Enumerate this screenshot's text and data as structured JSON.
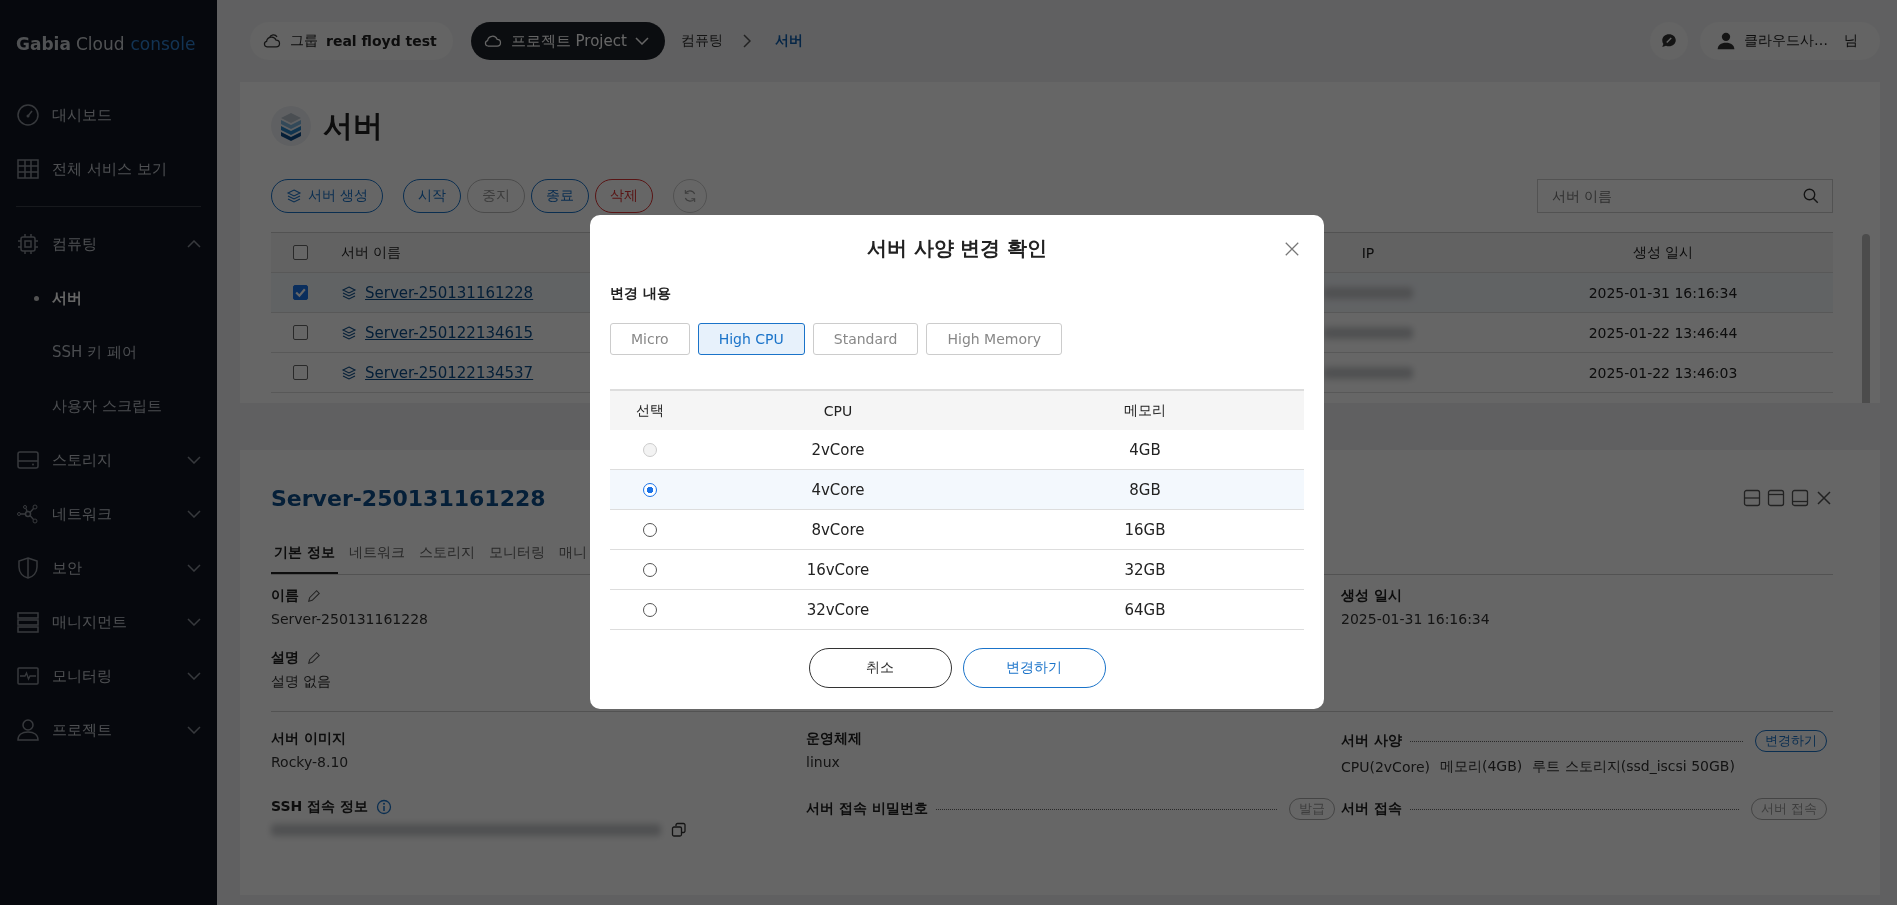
{
  "sidebar": {
    "logo": {
      "brand": "Gabia",
      "product": "Cloud",
      "suffix": "console"
    },
    "links": [
      {
        "label": "대시보드"
      },
      {
        "label": "전체 서비스 보기"
      }
    ],
    "menus": [
      {
        "label": "컴퓨팅",
        "expanded": true,
        "children": [
          {
            "label": "서버",
            "selected": true
          },
          {
            "label": "SSH 키 페어",
            "selected": false
          },
          {
            "label": "사용자 스크립트",
            "selected": false
          }
        ]
      },
      {
        "label": "스토리지",
        "expanded": false
      },
      {
        "label": "네트워크",
        "expanded": false
      },
      {
        "label": "보안",
        "expanded": false
      },
      {
        "label": "매니지먼트",
        "expanded": false
      },
      {
        "label": "모니터링",
        "expanded": false
      },
      {
        "label": "프로젝트",
        "expanded": false
      }
    ]
  },
  "topbar": {
    "group_label": "그룹",
    "group_name": "real floyd test",
    "project": "프로젝트 Project",
    "breadcrumb": [
      {
        "label": "컴퓨팅",
        "selected": false
      },
      {
        "label": "서버",
        "selected": true
      }
    ],
    "user_name": "클라우드사…",
    "user_suffix": "님"
  },
  "server_list": {
    "title": "서버",
    "toolbar": [
      {
        "label": "서버 생성",
        "kind": "create"
      },
      {
        "label": "시작",
        "kind": "primary"
      },
      {
        "label": "중지",
        "kind": "disabled"
      },
      {
        "label": "종료",
        "kind": "primary"
      },
      {
        "label": "삭제",
        "kind": "danger"
      },
      {
        "kind": "refresh"
      }
    ],
    "search": {
      "placeholder": "서버 이름"
    },
    "table": {
      "all_checked": false,
      "columns": [
        "서버 이름",
        "IP",
        "생성 일시"
      ],
      "rows": [
        {
          "checked": true,
          "name": "Server-250131161228",
          "created": "2025-01-31 16:16:34"
        },
        {
          "checked": false,
          "name": "Server-250122134615",
          "created": "2025-01-22 13:46:44"
        },
        {
          "checked": false,
          "name": "Server-250122134537",
          "created": "2025-01-22 13:46:03"
        }
      ]
    }
  },
  "detail": {
    "title": "Server-250131161228",
    "tabs": [
      {
        "label": "기본 정보",
        "selected": true
      },
      {
        "label": "네트워크",
        "selected": false
      },
      {
        "label": "스토리지",
        "selected": false
      },
      {
        "label": "모니터링",
        "selected": false
      },
      {
        "label": "매니",
        "selected": false
      }
    ],
    "name": {
      "label": "이름",
      "value": "Server-250131161228"
    },
    "description": {
      "label": "설명",
      "value": "설명 없음"
    },
    "created": {
      "label": "생성 일시",
      "value": "2025-01-31 16:16:34"
    },
    "image": {
      "label": "서버 이미지",
      "value": "Rocky-8.10"
    },
    "os": {
      "label": "운영체제",
      "value": "linux"
    },
    "spec": {
      "label": "서버 사양",
      "action": {
        "label": "변경하기",
        "disabled": false
      },
      "values": [
        "CPU(2vCore)",
        "메모리(4GB)",
        "루트 스토리지(ssd_iscsi 50GB)"
      ]
    },
    "ssh": {
      "label": "SSH 접속 정보"
    },
    "password": {
      "label": "서버 접속 비밀번호",
      "action": {
        "label": "발급",
        "disabled": true
      }
    },
    "access": {
      "label": "서버 접속",
      "action": {
        "label": "서버 접속",
        "disabled": true
      }
    }
  },
  "modal": {
    "title": "서버 사양 변경 확인",
    "section": "변경 내용",
    "categories": [
      {
        "label": "Micro",
        "selected": false
      },
      {
        "label": "High CPU",
        "selected": true
      },
      {
        "label": "Standard",
        "selected": false
      },
      {
        "label": "High Memory",
        "selected": false
      }
    ],
    "columns": [
      "선택",
      "CPU",
      "메모리"
    ],
    "options": [
      {
        "cpu": "2vCore",
        "memory": "4GB",
        "selected": false,
        "disabled": true
      },
      {
        "cpu": "4vCore",
        "memory": "8GB",
        "selected": true,
        "disabled": false
      },
      {
        "cpu": "8vCore",
        "memory": "16GB",
        "selected": false,
        "disabled": false
      },
      {
        "cpu": "16vCore",
        "memory": "32GB",
        "selected": false,
        "disabled": false
      },
      {
        "cpu": "32vCore",
        "memory": "64GB",
        "selected": false,
        "disabled": false
      }
    ],
    "buttons": [
      {
        "label": "취소",
        "kind": "cancel"
      },
      {
        "label": "변경하기",
        "kind": "confirm"
      }
    ]
  }
}
